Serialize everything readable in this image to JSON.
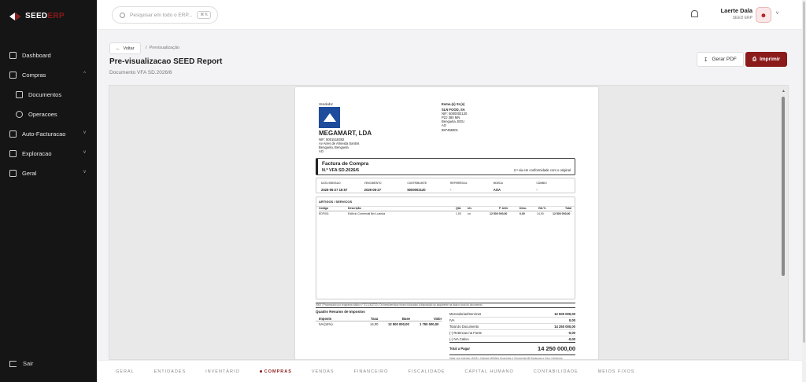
{
  "brand": {
    "seed": "SEED",
    "erp": "ERP"
  },
  "nav": [
    {
      "label": "Dashboard",
      "icon": "dashboard-icon"
    },
    {
      "label": "Compras",
      "icon": "cart-icon",
      "expanded": true
    },
    {
      "label": "Documentos",
      "icon": "document-icon",
      "sub": true
    },
    {
      "label": "Operacoes",
      "icon": "operations-icon",
      "sub": true
    },
    {
      "label": "Auto-Facturacao",
      "icon": "invoice-icon"
    },
    {
      "label": "Exploracao",
      "icon": "explore-icon"
    },
    {
      "label": "Geral",
      "icon": "grid-icon"
    }
  ],
  "logout": "Sair",
  "search": {
    "placeholder": "Pesquisar em todo o ERP...",
    "shortcut": "⌘ K"
  },
  "user": {
    "name": "Laerte Dala",
    "org": "SEED ERP"
  },
  "page": {
    "back": "Voltar",
    "crumb": "Previsualização",
    "title": "Pre-visualizacao SEED Report",
    "subtitle": "Documento VFA SD.2026/6",
    "pdf": "Gerar PDF",
    "print": "Imprimir"
  },
  "doc": {
    "vendor_label": "Vendedor",
    "vendor": "MEGAMART, LDA",
    "vendor_nif": "NIF: 5001518392",
    "vendor_addr1": "Av Aires de Almeida Santos",
    "vendor_addr2": "Benguela, Benguela",
    "vendor_addr3": "AO",
    "buyer_label": "Exmo.(s) Sr.(s)",
    "buyer": "SLN FOOD, SA",
    "buyer_nif": "NIF: 5000002120",
    "buyer_addr1": "PZJ 380 MN",
    "buyer_addr2": "Benguela, BGU",
    "buyer_addr3": "AO",
    "buyer_phone": "987458201",
    "type": "Factura de Compra",
    "number": "N.º VFA SD.2026/6",
    "copy": "2.ª via em conformidade com o original",
    "meta": [
      {
        "l": "DATA EMISSAO",
        "v": "2026-05-27 16:57"
      },
      {
        "l": "VENCIMENTO",
        "v": "2026-05-27"
      },
      {
        "l": "CONTRIBUINTE",
        "v": "5000002120"
      },
      {
        "l": "REFERÊNCIA",
        "v": "-"
      },
      {
        "l": "MOEDA",
        "v": "AOA"
      },
      {
        "l": "CÂMBIO",
        "v": "-"
      }
    ],
    "items_title": "ARTIGOS / SERVICOS",
    "cols": [
      "Código",
      "Descrição",
      "Qtd.",
      "Un.",
      "P. Unit.",
      "Desc.",
      "IVA %",
      "Total"
    ],
    "row": [
      "EDF001",
      "Edifício Comercial Bm Luanda",
      "1,00",
      "un",
      "12 500 000,00",
      "0,00",
      "14,00",
      "12 500 000,00"
    ],
    "footnote": "0000 | Processado por programa válido n.º 31.1/AGT20 | Os bens/serviços foram colocados à disposição do adquirente na data e local do documento.",
    "tax_title": "Quadro Resumo de Impostos",
    "tax_cols": [
      "Imposto",
      "Taxa",
      "Base",
      "Valor"
    ],
    "tax_row": [
      "IVA(14%)",
      "14,00",
      "12 500 000,00",
      "1 750 000,00"
    ],
    "totals": [
      {
        "l": "Mercadorias/Servicos",
        "v": "12 500 000,00"
      },
      {
        "l": "IVA",
        "v": "0,00"
      },
      {
        "l": "Total do Documento",
        "v": "14 250 000,00"
      },
      {
        "l": "(-) Retencao na Fonte",
        "v": "-0,00"
      },
      {
        "l": "(-) IVA Cativo",
        "v": "-0,00"
      }
    ],
    "pay_label": "Total a Pagar",
    "pay_value": "14 250 000,00",
    "words": "Valor por extenso (AOA): Catorze Milhões Duzentos e Cinquenta Mil Kwanzas e Zero Centimos"
  },
  "tabs": [
    "GERAL",
    "ENTIDADES",
    "INVENTÁRIO",
    "COMPRAS",
    "VENDAS",
    "FINANCEIRO",
    "FISCALIDADE",
    "CAPITAL HUMANO",
    "CONTABILIDADE",
    "MEIOS FIXOS"
  ],
  "colors": {
    "accent": "#8b1a1a",
    "sidebar": "#151515"
  }
}
